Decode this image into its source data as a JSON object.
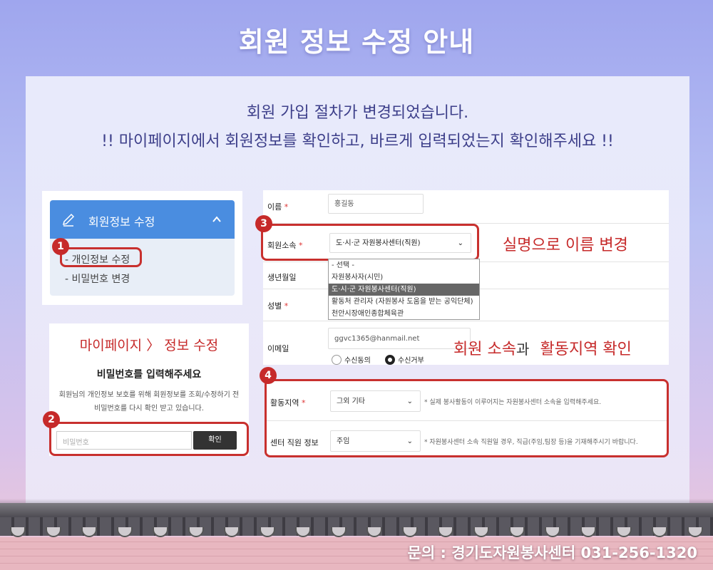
{
  "title": "회원 정보 수정 안내",
  "notice": {
    "line1": "회원 가입 절차가 변경되었습니다.",
    "line2": "!! 마이페이지에서 회원정보를 확인하고, 바르게 입력되었는지 확인해주세요 !!"
  },
  "menu": {
    "header": "회원정보 수정",
    "items": [
      "- 개인정보 수정",
      "- 비밀번호 변경"
    ]
  },
  "badges": [
    "1",
    "2",
    "3",
    "4"
  ],
  "password": {
    "title": "마이페이지 〉 정보 수정",
    "subtitle": "비밀번호를 입력해주세요",
    "desc1": "회원님의 개인정보 보호를 위해 회원정보를 조회/수정하기 전",
    "desc2": "비밀번호를 다시 확인 받고 있습니다.",
    "placeholder": "비밀번호",
    "button": "확인"
  },
  "form": {
    "name_label": "이름",
    "name_value": "홍길동",
    "org_label": "회원소속",
    "org_value": "도·시·군 자원봉사센터(직원)",
    "org_options": [
      "- 선택 -",
      "자원봉사자(시민)",
      "도·시·군 자원봉사센터(직원)",
      "활동처 관리자 (자원봉사 도움을 받는 공익단체)",
      "천안시장애인종합체육관"
    ],
    "birth_label": "생년월일",
    "gender_label": "성별",
    "email_label": "이메일",
    "email_value": "ggvc1365@hanmail.net",
    "radio_agree": "수신동의",
    "radio_reject": "수신거부",
    "required_mark": "*"
  },
  "form2": {
    "region_label": "활동지역",
    "region_value": "그외 기타",
    "region_note": "* 실제 봉사활동이 이루어지는 자원봉사센터 소속을 입력해주세요.",
    "staff_label": "센터 직원 정보",
    "staff_value": "주임",
    "staff_note": "* 자원봉사센터 소속 직원일 경우, 직급(주임,팀장 등)을 기재해주시기 바랍니다."
  },
  "annotations": {
    "realname": "실명으로 이름 변경",
    "org_part1": "회원 소속",
    "org_part2": "과",
    "org_part3": "활동지역 확인"
  },
  "contact": "문의 : 경기도자원봉사센터 031-256-1320",
  "colors": {
    "accent_red": "#c62a2a",
    "menu_blue": "#4a8de0",
    "notice_text": "#3d3f8a"
  }
}
